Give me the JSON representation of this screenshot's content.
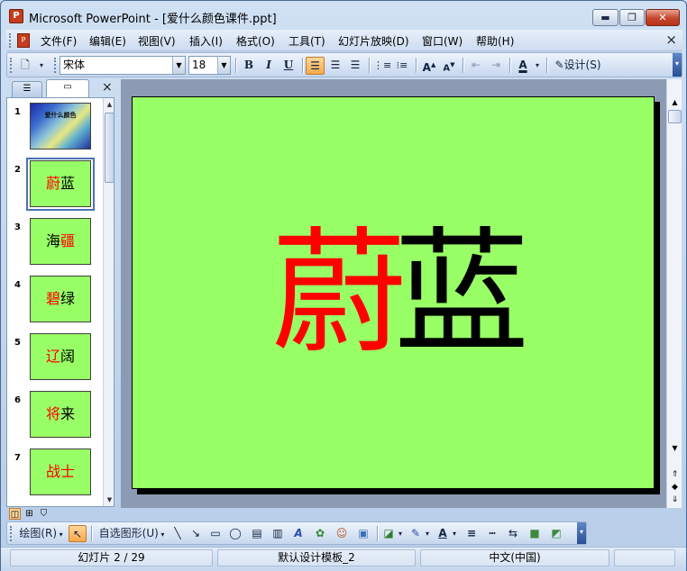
{
  "window": {
    "title": "Microsoft PowerPoint - [爱什么颜色课件.ppt]",
    "app_icon": "powerpoint-icon",
    "minimize": "▬",
    "maximize": "❐",
    "close": "✕"
  },
  "menu": {
    "items": [
      "文件(F)",
      "编辑(E)",
      "视图(V)",
      "插入(I)",
      "格式(O)",
      "工具(T)",
      "幻灯片放映(D)",
      "窗口(W)",
      "帮助(H)"
    ],
    "close_glyph": "×"
  },
  "toolbar": {
    "font_name": "宋体",
    "font_size": "18",
    "bold": "B",
    "italic": "I",
    "underline": "U",
    "design_label": "设计(S)",
    "colors": {
      "active_align": "#f6a94b",
      "font_color": "#000000"
    }
  },
  "outline_pane": {
    "tabs": [
      "outline-tab-icon",
      "slides-tab-icon"
    ],
    "close_glyph": "×",
    "slides": [
      {
        "num": "1",
        "left": "",
        "right": "",
        "title_small": "爱什么颜色"
      },
      {
        "num": "2",
        "left": "蔚",
        "right": "蓝"
      },
      {
        "num": "3",
        "left": "海",
        "right": "疆"
      },
      {
        "num": "4",
        "left": "碧",
        "right": "绿"
      },
      {
        "num": "5",
        "left": "辽",
        "right": "阔"
      },
      {
        "num": "6",
        "left": "将",
        "right": "来"
      },
      {
        "num": "7",
        "left": "战",
        "right": "士"
      }
    ],
    "selected_slide": 2
  },
  "slide": {
    "title_red": "蔚",
    "title_black": "蓝",
    "background": "#99ff66",
    "red_color": "#ff0000",
    "black_color": "#000000"
  },
  "drawing_toolbar": {
    "draw_label": "绘图(R)",
    "autoshapes_label": "自选图形(U)"
  },
  "status": {
    "slide_position": "幻灯片 2 / 29",
    "template": "默认设计模板_2",
    "language": "中文(中国)"
  }
}
